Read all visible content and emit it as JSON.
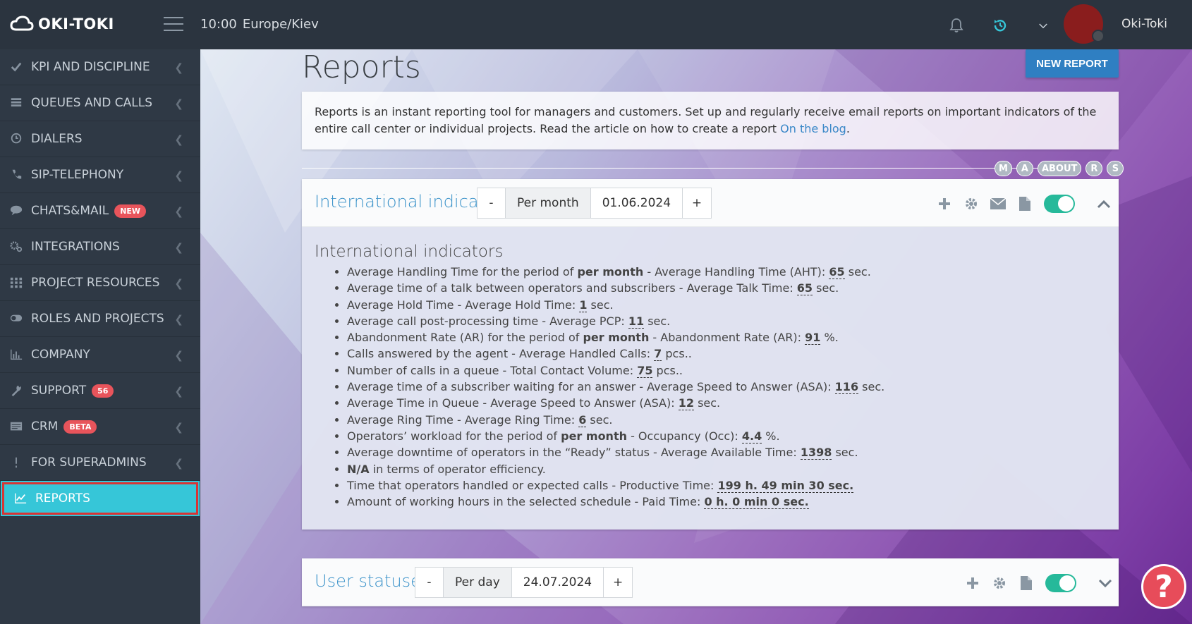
{
  "app": {
    "name": "OKI-TOKI",
    "time": "10:00",
    "timezone": "Europe/Kiev",
    "username": "Oki-Toki"
  },
  "sidebar": {
    "items": [
      {
        "label": "KPI AND DISCIPLINE",
        "icon": "check-icon"
      },
      {
        "label": "QUEUES AND CALLS",
        "icon": "list-icon"
      },
      {
        "label": "DIALERS",
        "icon": "clock-icon"
      },
      {
        "label": "SIP-TELEPHONY",
        "icon": "phone-icon"
      },
      {
        "label": "CHATS&MAIL",
        "icon": "chat-icon",
        "badge": "NEW"
      },
      {
        "label": "INTEGRATIONS",
        "icon": "gears-icon"
      },
      {
        "label": "PROJECT RESOURCES",
        "icon": "grid-icon"
      },
      {
        "label": "ROLES AND PROJECTS",
        "icon": "toggle-icon"
      },
      {
        "label": "COMPANY",
        "icon": "bar-chart-icon"
      },
      {
        "label": "SUPPORT",
        "icon": "wrench-icon",
        "badge": "56"
      },
      {
        "label": "CRM",
        "icon": "card-icon",
        "badge": "BETA"
      },
      {
        "label": "FOR SUPERADMINS",
        "icon": "exclamation-icon"
      },
      {
        "label": "REPORTS",
        "icon": "line-chart-icon",
        "active": true
      }
    ]
  },
  "page": {
    "title": "Reports",
    "new_report_label": "NEW REPORT",
    "info_text": "Reports is an instant reporting tool for managers and customers. Set up and regularly receive email reports on important indicators of the entire call center or individual projects. Read the article on how to create a report ",
    "info_link": "On the blog",
    "info_end": ".",
    "pills": [
      "M",
      "A",
      "ABOUT",
      "R",
      "S"
    ]
  },
  "reports": [
    {
      "title": "International indicators",
      "minus": "-",
      "period": "Per month",
      "date": "01.06.2024",
      "plus": "+",
      "body_title": "International indicators"
    },
    {
      "title": "User statuses",
      "minus": "-",
      "period": "Per day",
      "date": "24.07.2024",
      "plus": "+"
    }
  ],
  "indicators": [
    {
      "pre": "Average Handling Time for the period of ",
      "bold": "per month",
      "mid": " - Average Handling Time (AHT): ",
      "value": "65",
      "unit": " sec."
    },
    {
      "pre": "Average time of a talk between operators and subscribers - Average Talk Time: ",
      "bold": "",
      "mid": "",
      "value": "65",
      "unit": " sec."
    },
    {
      "pre": "Average Hold Time - Average Hold Time: ",
      "bold": "",
      "mid": "",
      "value": "1",
      "unit": " sec."
    },
    {
      "pre": "Average call post-processing time - Average PCP: ",
      "bold": "",
      "mid": "",
      "value": "11",
      "unit": " sec."
    },
    {
      "pre": "Abandonment Rate (AR) for the period of ",
      "bold": "per month",
      "mid": " - Abandonment Rate (AR): ",
      "value": "91",
      "unit": " %."
    },
    {
      "pre": "Calls answered by the agent - Average Handled Calls: ",
      "bold": "",
      "mid": "",
      "value": "7",
      "unit": " pcs.."
    },
    {
      "pre": "Number of calls in a queue - Total Contact Volume: ",
      "bold": "",
      "mid": "",
      "value": "75",
      "unit": " pcs.."
    },
    {
      "pre": "Average time of a subscriber waiting for an answer - Average Speed to Answer (ASA): ",
      "bold": "",
      "mid": "",
      "value": "116",
      "unit": " sec."
    },
    {
      "pre": "Average Time in Queue - Average Speed to Answer (ASA): ",
      "bold": "",
      "mid": "",
      "value": "12",
      "unit": " sec."
    },
    {
      "pre": "Average Ring Time - Average Ring Time: ",
      "bold": "",
      "mid": "",
      "value": "6",
      "unit": " sec."
    },
    {
      "pre": "Operators’ workload for the period of ",
      "bold": "per month",
      "mid": " - Occupancy (Occ): ",
      "value": "4.4",
      "unit": " %."
    },
    {
      "pre": "Average downtime of operators in the “Ready” status - Average Available Time: ",
      "bold": "",
      "mid": "",
      "value": "1398",
      "unit": " sec."
    },
    {
      "pre": "",
      "bold": "N/A",
      "mid": " in terms of operator efficiency.",
      "value": "",
      "unit": ""
    },
    {
      "pre": "Time that operators handled or expected calls - Productive Time: ",
      "bold": "",
      "mid": "",
      "value": "199 h. 49 min 30 sec.",
      "unit": ""
    },
    {
      "pre": "Amount of working hours in the selected schedule - Paid Time: ",
      "bold": "",
      "mid": "",
      "value": "0 h. 0 min 0 sec.",
      "unit": ""
    }
  ],
  "help": {
    "label": "?"
  },
  "colors": {
    "accent": "#36c6d8",
    "primary": "#2f7fc2",
    "toggle_on": "#26b99a",
    "badge": "#e8545b",
    "title_blue": "#3a92c9"
  }
}
